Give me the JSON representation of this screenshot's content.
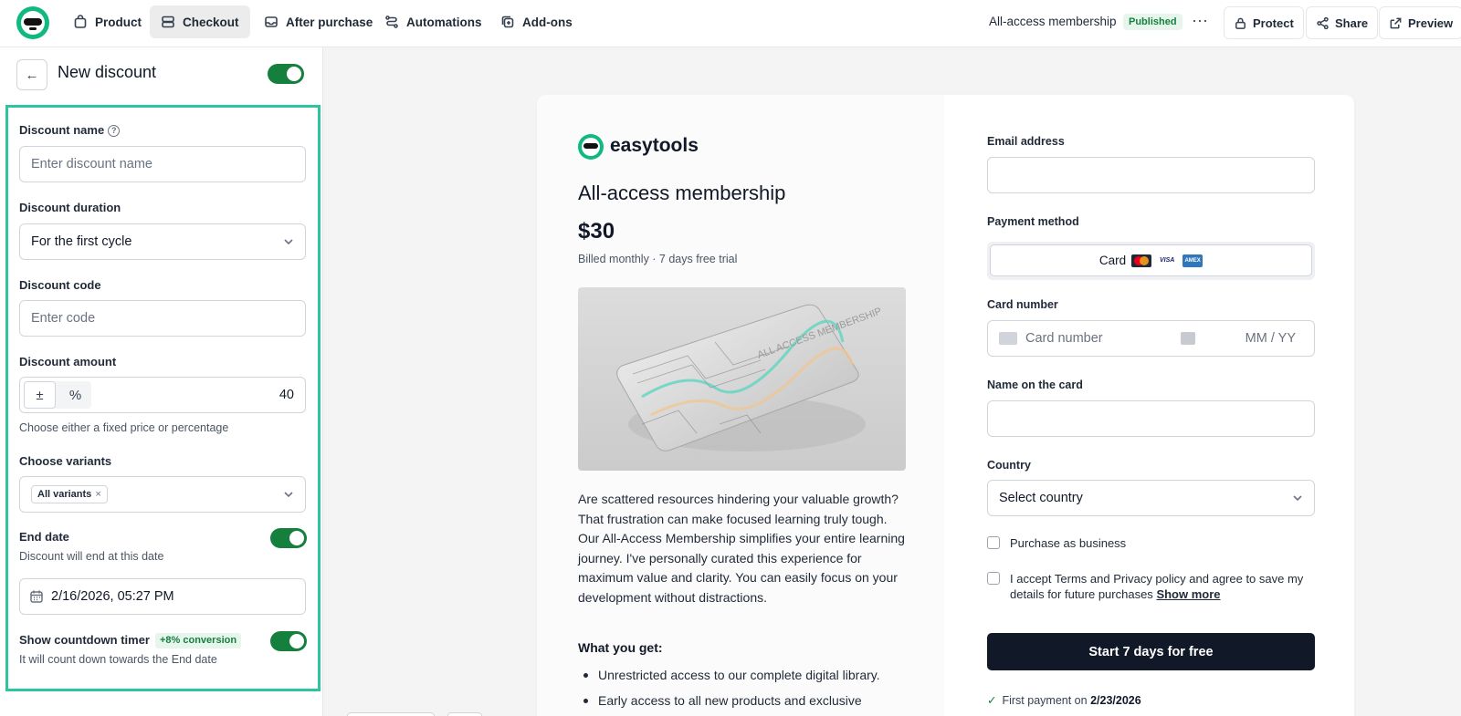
{
  "nav": {
    "tabs": [
      {
        "label": "Product",
        "icon": "bag-icon"
      },
      {
        "label": "Checkout",
        "icon": "checkout-icon"
      },
      {
        "label": "After purchase",
        "icon": "inbox-icon"
      },
      {
        "label": "Automations",
        "icon": "automation-icon"
      },
      {
        "label": "Add-ons",
        "icon": "addon-icon"
      }
    ],
    "active_tab": "Checkout",
    "product_name": "All-access membership",
    "status_badge": "Published",
    "more": "···",
    "protect_label": "Protect",
    "share_label": "Share",
    "preview_label": "Preview"
  },
  "panel": {
    "back_icon": "←",
    "title": "New discount",
    "enabled": true,
    "discount_name_label": "Discount name",
    "discount_name_placeholder": "Enter discount name",
    "duration_label": "Discount duration",
    "duration_value": "For the first cycle",
    "code_label": "Discount code",
    "code_placeholder": "Enter code",
    "amount_label": "Discount amount",
    "amount_mode_fixed": "±",
    "amount_mode_percent": "%",
    "amount_value": "40",
    "amount_hint": "Choose either a fixed price or percentage",
    "variants_label": "Choose variants",
    "variants_chip": "All variants",
    "chip_remove": "×",
    "end_date_label": "End date",
    "end_date_hint": "Discount will end at this date",
    "end_date_enabled": true,
    "end_date_value": "2/16/2026, 05:27 PM",
    "countdown_label": "Show countdown timer",
    "countdown_badge": "+8% conversion",
    "countdown_enabled": true,
    "countdown_hint": "It will count down towards the End date"
  },
  "preview": {
    "brand": "easytools",
    "product_title": "All-access membership",
    "price": "$30",
    "billing": "Billed monthly · 7 days free trial",
    "image_card_text": "ALL ACCESS MEMBERSHIP",
    "description": "Are scattered resources hindering your valuable growth? That frustration can make focused learning truly tough. Our All-Access Membership simplifies your entire learning journey. I've personally curated this experience for maximum value and clarity. You can easily focus on your development without distractions.",
    "what_you_get_title": "What you get:",
    "benefits": [
      "Unrestricted access to our complete digital library.",
      "Early access to all new products and exclusive"
    ],
    "email_label": "Email address",
    "payment_method_label": "Payment method",
    "payment_card_label": "Card",
    "card_brands": [
      "mastercard",
      "VISA",
      "AMEX"
    ],
    "card_number_label": "Card number",
    "card_number_placeholder": "Card number",
    "expiry_placeholder": "MM / YY",
    "name_on_card_label": "Name on the card",
    "country_label": "Country",
    "country_value": "Select country",
    "business_label": "Purchase as business",
    "terms_text": "I accept Terms and Privacy policy and agree to save my details for future purchases",
    "show_more": "Show more",
    "cta": "Start 7 days for free",
    "first_payment_prefix": "First payment on",
    "first_payment_date": "2/23/2026"
  },
  "colors": {
    "accent_green": "#15803d",
    "brand_teal": "#10b981",
    "focus_outline": "#2ec4a0",
    "cta_bg": "#111827"
  }
}
